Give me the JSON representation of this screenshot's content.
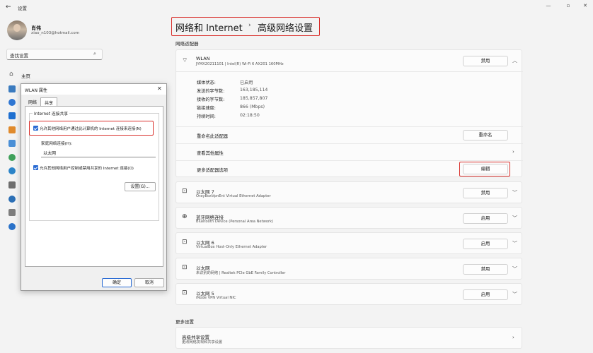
{
  "window": {
    "title": "设置",
    "back_icon": "back-arrow-icon"
  },
  "user": {
    "name": "肖伟",
    "email": "xiao_n103@hotmail.com"
  },
  "search": {
    "placeholder": "查找设置",
    "value": "查找设置"
  },
  "sidebar": {
    "home_label": "主页"
  },
  "breadcrumb": {
    "parent": "网络和 Internet",
    "separator": "›",
    "current": "高级网络设置"
  },
  "sections": {
    "adapters": "网络适配器",
    "more": "更多设置"
  },
  "wlan": {
    "name": "WLAN",
    "desc": "JYMX20211101 | Intel(R) Wi-Fi 6 AX201 160MHz",
    "button": "禁用",
    "props": [
      {
        "key": "媒体状态:",
        "value": "已启用"
      },
      {
        "key": "发送的字节数:",
        "value": "163,185,114"
      },
      {
        "key": "接收的字节数:",
        "value": "185,857,807"
      },
      {
        "key": "链接速度:",
        "value": "866 (Mbps)"
      },
      {
        "key": "持续时间:",
        "value": "02:18:50"
      }
    ],
    "rename_label": "重命名此适配器",
    "rename_button": "重命名",
    "more_props_label": "查看其他属性",
    "more_options_label": "更多适配器选项",
    "edit_button": "编辑"
  },
  "adapters": [
    {
      "name": "以太网 7",
      "desc": "OrayBoxVpnEnt Virtual Ethernet Adapter",
      "button": "禁用"
    },
    {
      "name": "蓝牙网络连接",
      "desc": "Bluetooth Device (Personal Area Network)",
      "button": "启用"
    },
    {
      "name": "以太网 6",
      "desc": "VirtualBox Host-Only Ethernet Adapter",
      "button": "启用"
    },
    {
      "name": "以太网",
      "desc": "未识别的网络 | Realtek PCIe GbE Family Controller",
      "button": "禁用"
    },
    {
      "name": "以太网 5",
      "desc": "iNode VPN Virtual NIC",
      "button": "启用"
    }
  ],
  "sharing": {
    "name": "高级共享设置",
    "desc": "更改网络发现和共享设置"
  },
  "dialog": {
    "title": "WLAN 属性",
    "tabs": [
      "网络",
      "共享"
    ],
    "group_title": "Internet 连接共享",
    "cb1": "允许其他网络用户通过此计算机的 Internet 连接来连接(N)",
    "home_net_label": "家庭网络连接(H):",
    "home_net_value": "以太网",
    "cb2": "允许其他网络用户控制或禁用共享的 Internet 连接(O)",
    "settings_button": "设置(G)...",
    "ok": "确定",
    "cancel": "取消"
  },
  "colors": {
    "accent": "#2a6bd3",
    "highlight": "#d9302c"
  }
}
